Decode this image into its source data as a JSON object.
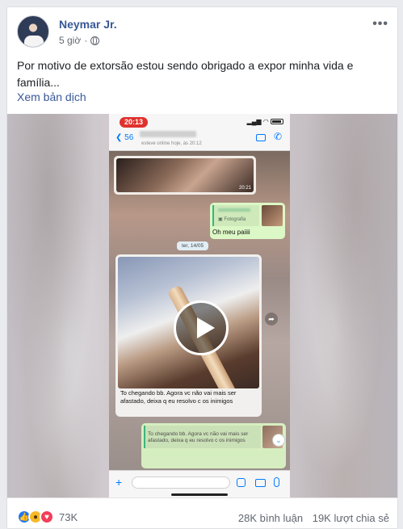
{
  "post": {
    "author": "Neymar Jr.",
    "time": "5 giờ",
    "text": "Por motivo de extorsão estou sendo obrigado a expor minha vida e família...",
    "translate_label": "Xem bản dịch"
  },
  "video": {
    "status_time": "20:13",
    "back_count": "56",
    "last_seen": "esteve online hoje, às 20:12",
    "photo_time": "20:21",
    "quote_label": "Fotografia",
    "reply_text": "Oh meu paiiii",
    "date_label": "ter, 14/05",
    "caption": "To chegando bb. Agora vc não vai mais ser afastado, deixa q eu resolvo c os inimigos",
    "bottom_quote": "To chegando bb. Agora vc não vai mais ser afastado, deixa q eu resolvo c os inimigos"
  },
  "footer": {
    "reaction_count": "73K",
    "comments": "28K bình luận",
    "shares": "19K lượt chia sẻ"
  },
  "icons": [
    "globe-icon",
    "more-icon",
    "play-icon",
    "like-reaction-icon",
    "wow-reaction-icon",
    "love-reaction-icon"
  ],
  "colors": {
    "link": "#385898",
    "like": "#2078f4",
    "love": "#f33e58",
    "wow": "#f7b928"
  }
}
